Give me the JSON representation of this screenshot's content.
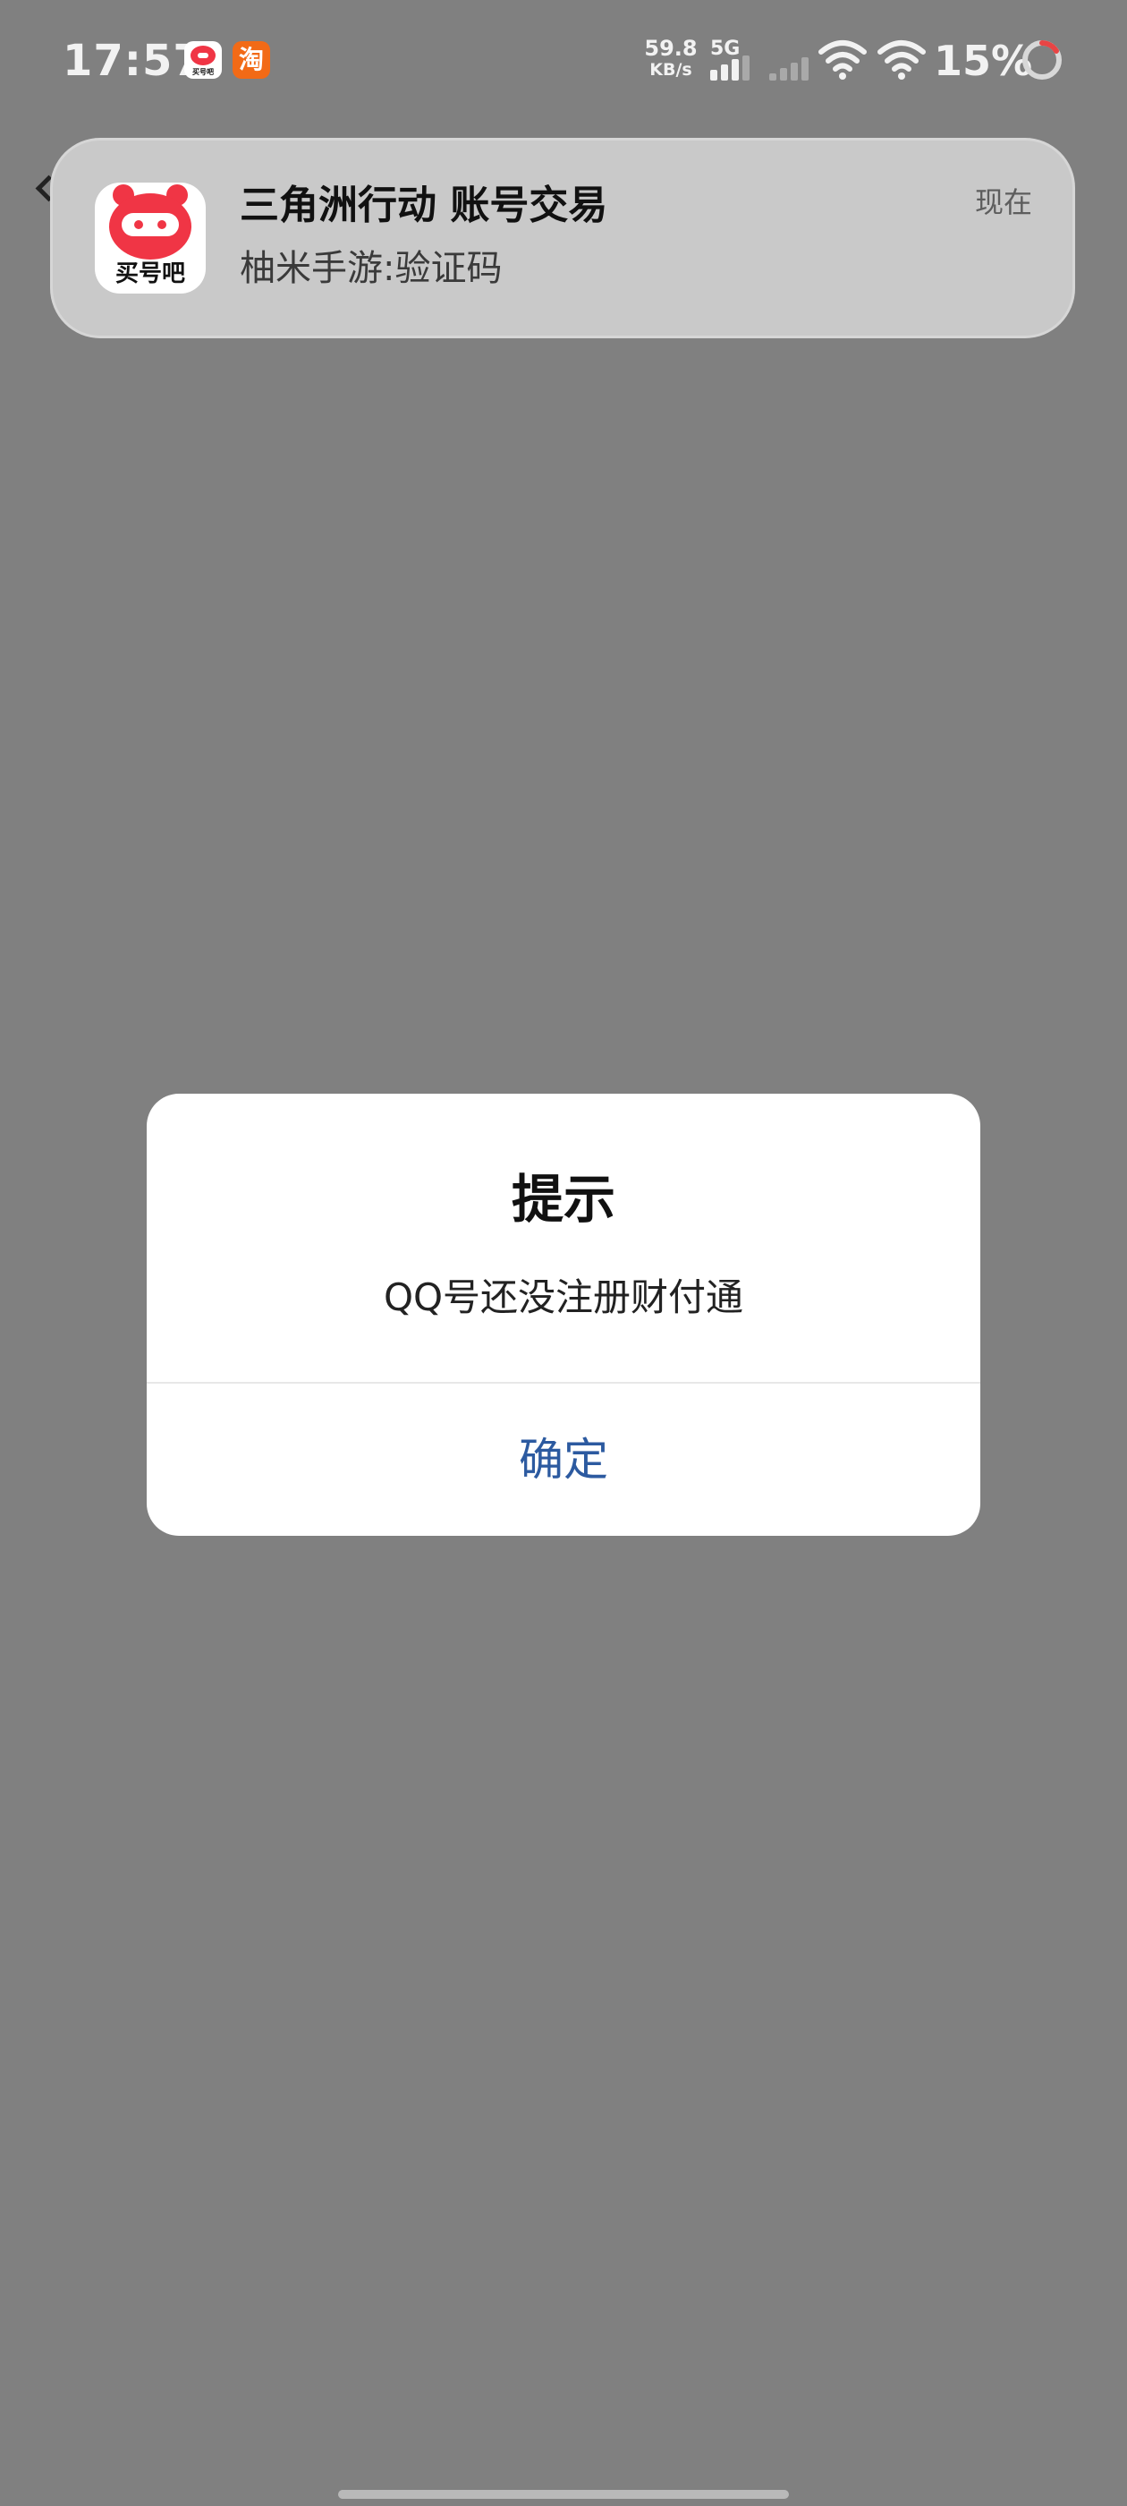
{
  "status_bar": {
    "time": "17:57",
    "net_speed_value": "59.8",
    "net_speed_unit": "KB/s",
    "network_label": "5G",
    "battery": "15%",
    "icons": [
      "maihaoba-app-icon",
      "taobao-app-icon",
      "signal-icon",
      "wifi-icon",
      "battery-ring-icon"
    ],
    "taobao_glyph": "淘",
    "maihaoba_glyph_text": "买号吧"
  },
  "notification": {
    "app_icon_label": "买号吧",
    "title": "三角洲行动 账号交易",
    "body": "柚米手游:验证码",
    "time": "现在"
  },
  "dialog": {
    "title": "提示",
    "message": "QQ号还没注册财付通",
    "confirm_label": "确定"
  },
  "colors": {
    "background_dim": "#808080",
    "notification_bg": "#c9c9c9",
    "dialog_bg": "#ffffff",
    "confirm_text": "#2c5aa0",
    "brand_red": "#f03545",
    "taobao_orange": "#f26a16"
  }
}
